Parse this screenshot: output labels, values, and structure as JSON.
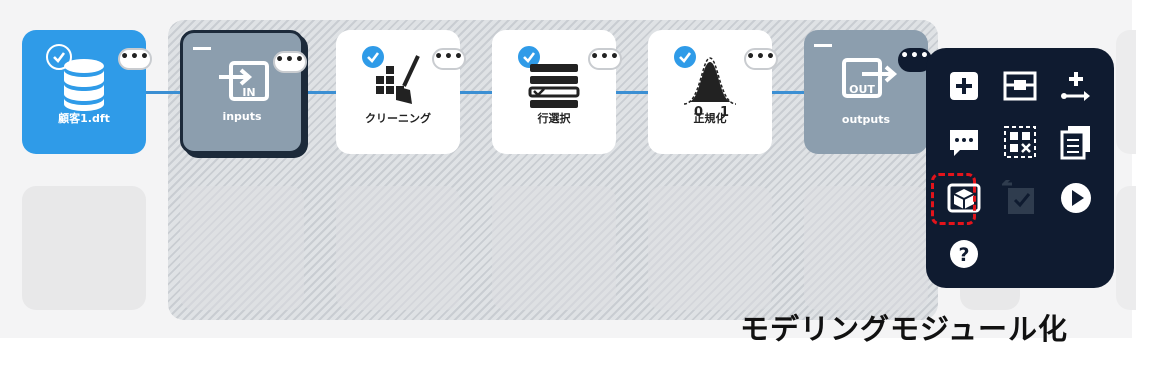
{
  "nodes": [
    {
      "label": "顧客1.dft",
      "icon": "database-icon"
    },
    {
      "label": "inputs",
      "icon": "input-icon"
    },
    {
      "label": "クリーニング",
      "icon": "cleaning-broom-icon"
    },
    {
      "label": "行選択",
      "icon": "row-select-icon"
    },
    {
      "label": "正規化",
      "icon": "normal-distribution-icon"
    },
    {
      "label": "outputs",
      "icon": "output-icon"
    }
  ],
  "more_glyph": "•••",
  "icon_text": {
    "in": "IN",
    "out": "OUT",
    "zero": "0",
    "one": "1",
    "help": "?"
  },
  "menu_items": [
    "add-icon",
    "pipeline-module-icon",
    "plus-arrow-icon",
    "comment-icon",
    "grid-remove-icon",
    "copy-modules-icon",
    "modeling-module-icon",
    "disabled-node-icon",
    "run-icon",
    "help-icon"
  ],
  "caption": "モデリングモジュール化",
  "colors": {
    "accent": "#2f9be8",
    "edge": "#3b8fd3",
    "menu_bg": "#0f1b30",
    "highlight": "#e3141b"
  }
}
